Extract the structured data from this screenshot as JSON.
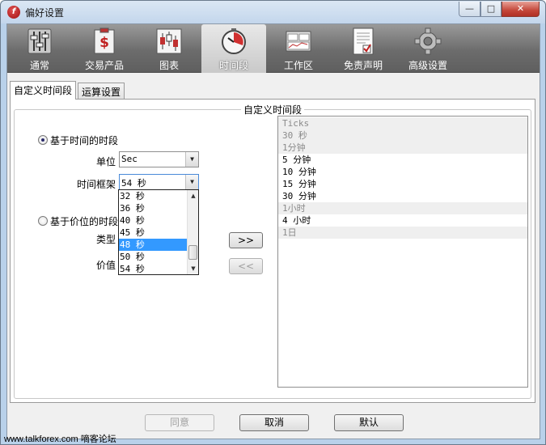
{
  "window": {
    "title": "偏好设置"
  },
  "toolbar": {
    "items": [
      {
        "label": "通常",
        "icon": "sliders-icon"
      },
      {
        "label": "交易产品",
        "icon": "dollar-document-icon"
      },
      {
        "label": "图表",
        "icon": "candlestick-chart-icon"
      },
      {
        "label": "时间段",
        "icon": "clock-icon"
      },
      {
        "label": "工作区",
        "icon": "workspace-icon"
      },
      {
        "label": "免责声明",
        "icon": "disclaimer-document-icon"
      },
      {
        "label": "高级设置",
        "icon": "gear-icon"
      }
    ],
    "active": "时间段"
  },
  "subtabs": [
    "自定义时间段",
    "运算设置"
  ],
  "group": {
    "legend": "自定义时间段"
  },
  "time_based": {
    "radio_label": "基于时间的时段",
    "unit_label": "单位",
    "unit_value": "Sec",
    "frame_label": "时间框架",
    "frame_value": "54 秒"
  },
  "price_based": {
    "radio_label": "基于价位的时段",
    "type_label": "类型",
    "value_label": "价值"
  },
  "dropdown": {
    "items": [
      "32 秒",
      "36 秒",
      "40 秒",
      "45 秒",
      "48 秒",
      "50 秒",
      "54 秒"
    ],
    "selected": "48 秒"
  },
  "move": {
    "add": ">>",
    "remove": "<<"
  },
  "list": {
    "items": [
      {
        "text": "Ticks",
        "dim": true
      },
      {
        "text": "30 秒",
        "dim": true
      },
      {
        "text": "1分钟",
        "dim": true
      },
      {
        "text": "5 分钟",
        "dim": false
      },
      {
        "text": "10 分钟",
        "dim": false
      },
      {
        "text": "15 分钟",
        "dim": false
      },
      {
        "text": "30 分钟",
        "dim": false
      },
      {
        "text": "1小时",
        "dim": true
      },
      {
        "text": "4 小时",
        "dim": false
      },
      {
        "text": "1日",
        "dim": true
      }
    ]
  },
  "buttons": {
    "ok": "同意",
    "cancel": "取消",
    "default": "默认"
  },
  "watermark": "www.talkforex.com 嘀客论坛"
}
